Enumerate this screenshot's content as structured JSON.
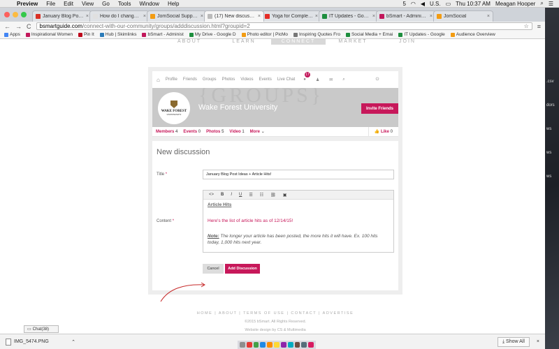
{
  "menubar": {
    "apple": "",
    "items": [
      "Preview",
      "File",
      "Edit",
      "View",
      "Go",
      "Tools",
      "Window",
      "Help"
    ],
    "status_a5": "5",
    "input_source": "U.S.",
    "clock": "Thu 10:37 AM",
    "user": "Meagan Hooper"
  },
  "tabs": [
    {
      "title": "January Blog Post Idea",
      "color": "#d93025"
    },
    {
      "title": "How do I change Group",
      "color": "#e0e0e0"
    },
    {
      "title": "JomSocial Support Foru",
      "color": "#f39c12"
    },
    {
      "title": "(17) New discussion",
      "color": "#bbbbbb"
    },
    {
      "title": "Yoga for Complete Begi",
      "color": "#e52d27"
    },
    {
      "title": "IT Updates - Google She",
      "color": "#1e8e3e"
    },
    {
      "title": "bSmart - Administration",
      "color": "#c2185b"
    },
    {
      "title": "JomSocial",
      "color": "#f39c12"
    }
  ],
  "toolbar": {
    "back": "←",
    "forward": "→",
    "reload": "C",
    "url_host": "bsmartguide.com",
    "url_path": "/connect-with-our-community/groups/adddiscussion.html?groupid=2",
    "star": "☆",
    "menu": "≡"
  },
  "bookmarks": [
    {
      "label": "Apps",
      "color": "#4285f4"
    },
    {
      "label": "Inspirational Women",
      "color": "#c2185b"
    },
    {
      "label": "Pin It",
      "color": "#bd081c"
    },
    {
      "label": "Hub | Skimlinks",
      "color": "#2b7bb9"
    },
    {
      "label": "bSmart - Administ",
      "color": "#c2185b"
    },
    {
      "label": "My Drive - Google D",
      "color": "#1e8e3e"
    },
    {
      "label": "Photo editor | PicMo",
      "color": "#f39c12"
    },
    {
      "label": "Inspiring Quotes Fro",
      "color": "#777777"
    },
    {
      "label": "Social Media + Emai",
      "color": "#1e8e3e"
    },
    {
      "label": "IT Updates - Google",
      "color": "#1e8e3e"
    },
    {
      "label": "Audience Overview",
      "color": "#f39c12"
    }
  ],
  "topnav": [
    "ABOUT",
    "LEARN",
    "CONNECT",
    "MARKET",
    "JOIN"
  ],
  "subnav": {
    "items": [
      "Profile",
      "Friends",
      "Groups",
      "Photos",
      "Videos",
      "Events",
      "Live Chat"
    ],
    "badge": "17"
  },
  "cover": {
    "bigword": "{GROUPS}",
    "logo_text": "WAKE FOREST",
    "logo_sub": "UNIVERSITY",
    "university": "Wake Forest University",
    "invite": "Invite Friends"
  },
  "stats": {
    "members_label": "Members",
    "members": "4",
    "events_label": "Events",
    "events": "0",
    "photos_label": "Photos",
    "photos": "5",
    "video_label": "Video",
    "video": "1",
    "more": "More",
    "like_label": "Like",
    "likes": "0"
  },
  "form": {
    "heading": "New discussion",
    "title_label": "Title",
    "title_value": "January Blog Post Ideas + Article Hits!",
    "content_label": "Content",
    "req": "*",
    "editor_heading": "Article Hits",
    "editor_line1": "Here's the list of article hits as of 12/14/15!",
    "editor_note_label": "Note:",
    "editor_note": " The longer your article has been posted, the more hits it will have.  Ex. 100 hits today, 1,000 hits next year.",
    "cancel": "Cancel",
    "submit": "Add Discussion"
  },
  "footer": {
    "links": "HOME  |  ABOUT  |  TERMS OF USE  |  CONTACT  |  ADVERTISE",
    "copyright": "©2015 bSmart. All Rights Reserved.",
    "credit": "Website design by CS & Multimedia"
  },
  "chat": "Chat(38)",
  "downloads": {
    "file": "IMG_5474.PNG",
    "show_all": "Show All"
  },
  "desktop": [
    ".csv",
    "dors",
    "ws",
    "ws",
    "ws"
  ]
}
